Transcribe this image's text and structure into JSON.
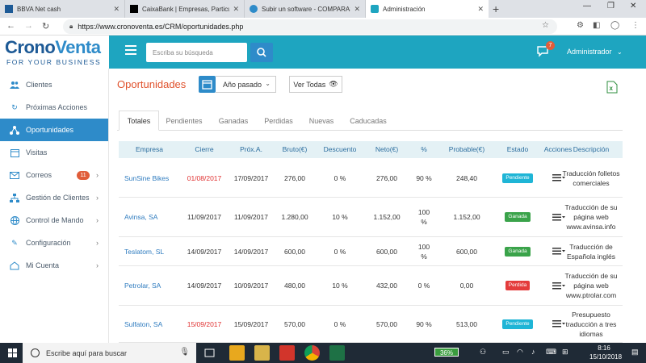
{
  "browser": {
    "tabs": [
      {
        "label": "BBVA Net cash",
        "icon": "bbva-icon",
        "color": "#1d5a96"
      },
      {
        "label": "CaixaBank | Empresas, Particulares",
        "icon": "caixabank-icon",
        "color": "#000000"
      },
      {
        "label": "Subir un software - COMPARASOFT",
        "icon": "comparasoft-icon",
        "color": "#2e8bc9"
      },
      {
        "label": "Administración",
        "icon": "cronoventa-icon",
        "color": "#1ea5c0"
      }
    ],
    "url": "https://www.cronoventa.es/CRM/oportunidades.php"
  },
  "header": {
    "logo_main_1": "Crono",
    "logo_main_2": "Venta",
    "logo_sub": "FOR YOUR BUSINESS",
    "search_placeholder": "Escriba su búsqueda",
    "chat_badge": "7",
    "user_menu": "Administrador",
    "accent": "#1ea5c0"
  },
  "sidebar": {
    "items": [
      {
        "label": "Clientes",
        "icon": "users-icon"
      },
      {
        "label": "Próximas Acciones",
        "icon": "refresh-icon"
      },
      {
        "label": "Oportunidades",
        "icon": "network-icon",
        "active": true
      },
      {
        "label": "Visitas",
        "icon": "calendar-icon"
      },
      {
        "label": "Correos",
        "icon": "mail-icon",
        "badge": "11"
      },
      {
        "label": "Gestión de Clientes",
        "icon": "sitemap-icon"
      },
      {
        "label": "Control de Mando",
        "icon": "globe-icon"
      },
      {
        "label": "Configuración",
        "icon": "pencil-icon"
      },
      {
        "label": "Mi Cuenta",
        "icon": "home-icon"
      }
    ]
  },
  "page": {
    "title": "Oportunidades",
    "period_select": "Año pasado",
    "view_all_label": "Ver Todas"
  },
  "tabs": [
    "Totales",
    "Pendientes",
    "Ganadas",
    "Perdidas",
    "Nuevas",
    "Caducadas"
  ],
  "table": {
    "headers": [
      "Empresa",
      "Cierre",
      "Próx.A.",
      "Bruto(€)",
      "Descuento",
      "Neto(€)",
      "%",
      "Probable(€)",
      "Estado",
      "Acciones",
      "Descripción"
    ],
    "rows": [
      {
        "empresa": "SunSine Bikes",
        "cierre": "01/08/2017",
        "cierre_overdue": true,
        "proxa": "17/09/2017",
        "bruto": "276,00",
        "descuento": "0 %",
        "neto": "276,00",
        "pct": "90 %",
        "probable": "248,40",
        "estado": "Pendiente",
        "descripcion": "Traducción folletos comerciales"
      },
      {
        "empresa": "Avinsa, SA",
        "cierre": "11/09/2017",
        "cierre_overdue": false,
        "proxa": "11/09/2017",
        "bruto": "1.280,00",
        "descuento": "10 %",
        "neto": "1.152,00",
        "pct": "100 %",
        "probable": "1.152,00",
        "estado": "Ganada",
        "descripcion": "Traducción de su página web www.avinsa.info"
      },
      {
        "empresa": "Teslatom, SL",
        "cierre": "14/09/2017",
        "cierre_overdue": false,
        "proxa": "14/09/2017",
        "bruto": "600,00",
        "descuento": "0 %",
        "neto": "600,00",
        "pct": "100 %",
        "probable": "600,00",
        "estado": "Ganada",
        "descripcion": "Traducción de Española inglés"
      },
      {
        "empresa": "Petrolar, SA",
        "cierre": "14/09/2017",
        "cierre_overdue": false,
        "proxa": "10/09/2017",
        "bruto": "480,00",
        "descuento": "10 %",
        "neto": "432,00",
        "pct": "0 %",
        "probable": "0,00",
        "estado": "Perdida",
        "descripcion": "Traducción de su página web www.ptrolar.com"
      },
      {
        "empresa": "Sulfaton, SA",
        "cierre": "15/09/2017",
        "cierre_overdue": true,
        "proxa": "15/09/2017",
        "bruto": "570,00",
        "descuento": "0 %",
        "neto": "570,00",
        "pct": "90 %",
        "probable": "513,00",
        "estado": "Pendiente",
        "descripcion": "Presupuesto traducción a tres idiomas"
      }
    ],
    "status_colors": {
      "Pendiente": "#1fb5d6",
      "Ganada": "#3aa34a",
      "Perdida": "#e43c3c"
    }
  },
  "taskbar": {
    "search_placeholder": "Escribe aquí para buscar",
    "battery": "36%",
    "time": "8:16",
    "date": "15/10/2018"
  }
}
